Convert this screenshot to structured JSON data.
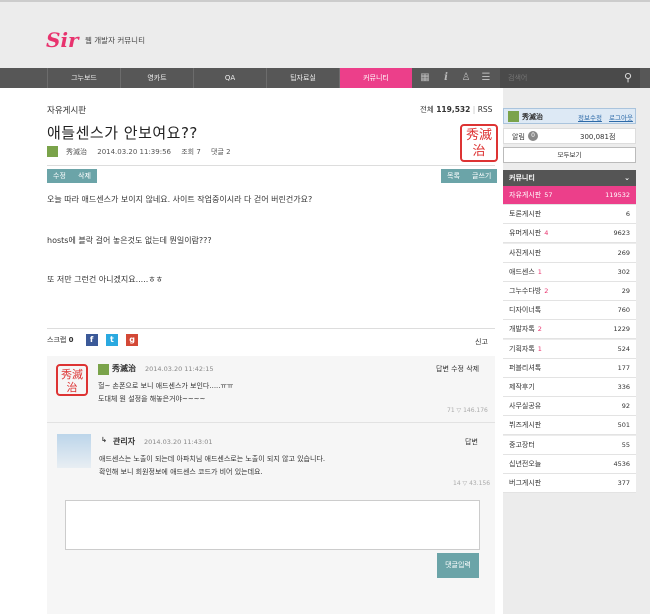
{
  "header": {
    "logo": "Sir",
    "subtitle": "웹 개발자 커뮤니티"
  },
  "nav": {
    "items": [
      "그누보드",
      "영카트",
      "QA",
      "팁자료실",
      "커뮤니티"
    ],
    "active_index": 4,
    "search_placeholder": "검색어"
  },
  "post": {
    "board_name": "자유게시판",
    "total_label": "전체",
    "total_count": "119,532",
    "rss": "RSS",
    "title": "애들센스가 안보여요??",
    "author": "秀滅治",
    "datetime": "2014.03.20 11:39:56",
    "views": "조회 7",
    "comments_label": "댓글 2",
    "seal_text": "秀滅治",
    "btn_edit": "수정",
    "btn_delete": "삭제",
    "btn_list": "목록",
    "btn_write": "글쓰기",
    "body": [
      "오늘 따라 애드센스가 보이지 않네요. 사이트 작업중이시라 다 걷어 버린건가요?",
      "hosts에 블락 걸어 놓은것도 없는데 뭔일이람???",
      "또 저만 그런건 아니겠지요.....ㅎㅎ"
    ],
    "scrap_label": "스크랩",
    "scrap_count": "0",
    "report": "신고"
  },
  "comments": [
    {
      "author": "秀滅治",
      "date": "2014.03.20 11:42:15",
      "actions": "답변 수정 삭제",
      "lines": [
        "헐~ 손폰으로 보니 애드센스가 보인다.....ㅠㅠ",
        "도대체 뭔 설정을 해놓은거야~~~~"
      ],
      "stats": "71 ▽ 146.176"
    },
    {
      "author": "관리자",
      "date": "2014.03.20 11:43:01",
      "actions": "답변",
      "lines": [
        "애드센스는 노출이 되는데 아파치님 애드센스로는 노출이 되지 않고 있습니다.",
        "확인해 보니 회원정보에 애드센스 코드가 비어 있는데요."
      ],
      "stats": "14 ▽ 43.156"
    }
  ],
  "reply": {
    "submit": "댓글입력"
  },
  "sidebar": {
    "user": "秀滅治",
    "links": [
      "정보수정",
      "로그아웃"
    ],
    "alarm_label": "알림",
    "alarm_badge": "0",
    "points": "300,081점",
    "see_all": "모두보기",
    "category_header": "커뮤니티",
    "categories": [
      {
        "name": "자유게시판",
        "new": "57",
        "count": "119532"
      },
      {
        "name": "토론게시판",
        "new": "",
        "count": "6"
      },
      {
        "name": "유머게시판",
        "new": "4",
        "count": "9623"
      },
      {
        "name": "사진게시판",
        "new": "",
        "count": "269"
      },
      {
        "name": "애드센스",
        "new": "1",
        "count": "302"
      },
      {
        "name": "그누수다방",
        "new": "2",
        "count": "29"
      },
      {
        "name": "디자이너톡",
        "new": "",
        "count": "760"
      },
      {
        "name": "개발자톡",
        "new": "2",
        "count": "1229"
      },
      {
        "name": "기획자톡",
        "new": "1",
        "count": "524"
      },
      {
        "name": "퍼블리셔톡",
        "new": "",
        "count": "177"
      },
      {
        "name": "제작후기",
        "new": "",
        "count": "336"
      },
      {
        "name": "사무실공유",
        "new": "",
        "count": "92"
      },
      {
        "name": "뷔즈게시판",
        "new": "",
        "count": "501"
      },
      {
        "name": "중고장터",
        "new": "",
        "count": "55"
      },
      {
        "name": "십년전오늘",
        "new": "",
        "count": "4536"
      },
      {
        "name": "버그게시판",
        "new": "",
        "count": "377"
      }
    ]
  },
  "colors": {
    "accent": "#ec3f8a",
    "button": "#6ba4a8",
    "nav": "#575757"
  }
}
